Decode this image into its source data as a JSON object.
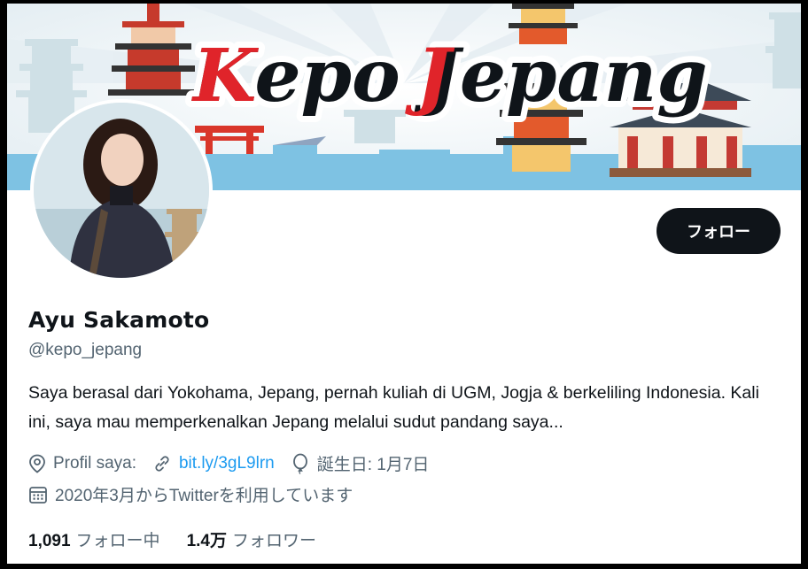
{
  "banner": {
    "title": "Kepo Jepang"
  },
  "profile": {
    "name": "Ayu Sakamoto",
    "handle": "@kepo_jepang",
    "bio": "Saya berasal dari Yokohama, Jepang, pernah kuliah di UGM, Jogja & berkeliling Indonesia. Kali ini, saya mau memperkenalkan Jepang melalui sudut pandang saya...",
    "follow_label": "フォロー"
  },
  "meta": {
    "location": "Profil saya:",
    "link": "bit.ly/3gL9lrn",
    "birthday": "誕生日: 1月7日",
    "joined": "2020年3月からTwitterを利用しています"
  },
  "stats": {
    "following_count": "1,091",
    "following_label": "フォロー中",
    "followers_count": "1.4万",
    "followers_label": "フォロワー"
  },
  "colors": {
    "accent": "#1d9bf0",
    "text": "#0f1419",
    "secondary": "#536471",
    "button": "#0f1419",
    "banner_red": "#e0242a"
  }
}
